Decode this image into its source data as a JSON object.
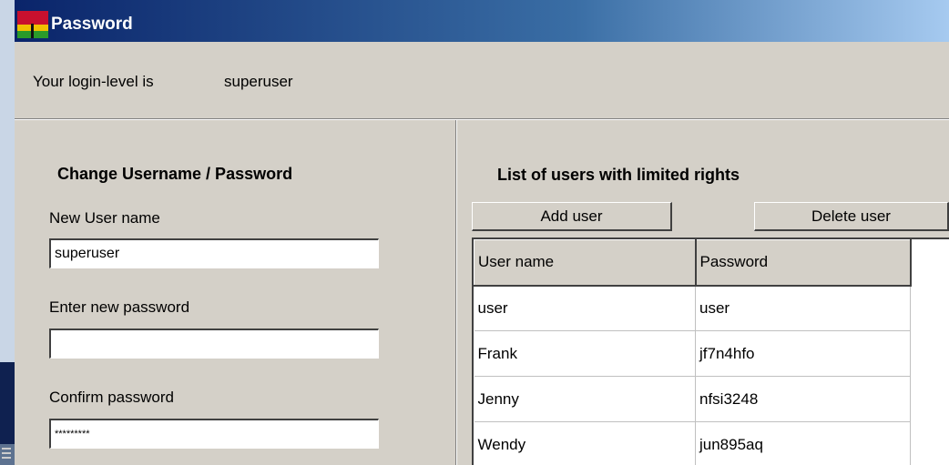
{
  "window": {
    "title": "Password",
    "icon": "app-flag-icon"
  },
  "login": {
    "label": "Your login-level is",
    "value": "superuser"
  },
  "change_panel": {
    "heading": "Change Username / Password",
    "username_label": "New User name",
    "username_value": "superuser",
    "new_password_label": "Enter new password",
    "new_password_value": "",
    "confirm_password_label": "Confirm password",
    "confirm_password_value": "*********"
  },
  "users_panel": {
    "heading": "List of users with limited rights",
    "add_button": "Add user",
    "delete_button": "Delete user",
    "columns": [
      "User name",
      "Password"
    ],
    "rows": [
      [
        "user",
        "user"
      ],
      [
        "Frank",
        "jf7n4hfo"
      ],
      [
        "Jenny",
        "nfsi3248"
      ],
      [
        "Wendy",
        "jun895aq"
      ]
    ]
  }
}
